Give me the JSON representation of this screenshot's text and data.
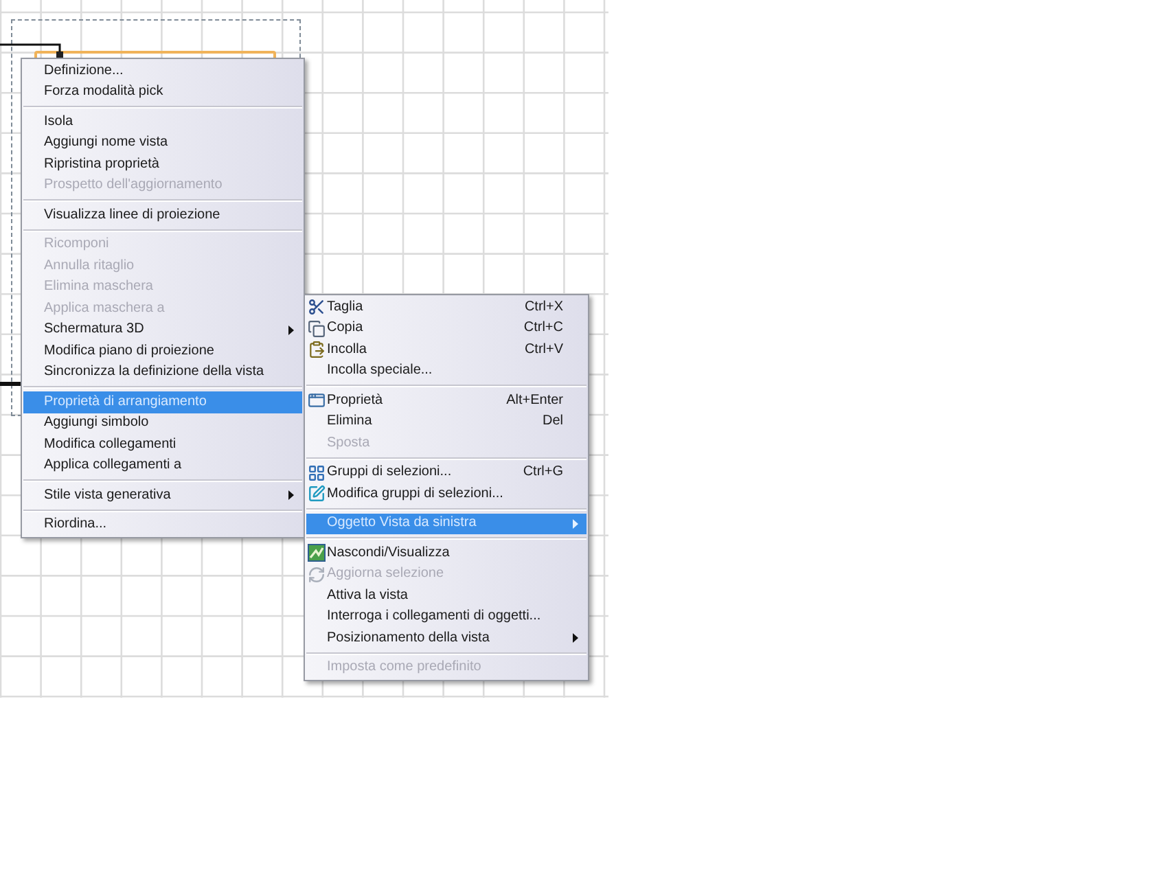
{
  "view_object_submenu": {
    "items": [
      {
        "kind": "command",
        "label": "Definizione...",
        "disabled": false,
        "selected": false,
        "submenu": false
      },
      {
        "kind": "command",
        "label": "Forza modalità pick",
        "disabled": false,
        "selected": false,
        "submenu": false
      },
      {
        "kind": "separator"
      },
      {
        "kind": "command",
        "label": "Isola",
        "disabled": false,
        "selected": false,
        "submenu": false
      },
      {
        "kind": "command",
        "label": "Aggiungi nome vista",
        "disabled": false,
        "selected": false,
        "submenu": false
      },
      {
        "kind": "command",
        "label": "Ripristina proprietà",
        "disabled": false,
        "selected": false,
        "submenu": false
      },
      {
        "kind": "command",
        "label": "Prospetto dell'aggiornamento",
        "disabled": true,
        "selected": false,
        "submenu": false
      },
      {
        "kind": "separator"
      },
      {
        "kind": "command",
        "label": "Visualizza linee di proiezione",
        "disabled": false,
        "selected": false,
        "submenu": false
      },
      {
        "kind": "separator"
      },
      {
        "kind": "command",
        "label": "Ricomponi",
        "disabled": true,
        "selected": false,
        "submenu": false
      },
      {
        "kind": "command",
        "label": "Annulla ritaglio",
        "disabled": true,
        "selected": false,
        "submenu": false
      },
      {
        "kind": "command",
        "label": "Elimina maschera",
        "disabled": true,
        "selected": false,
        "submenu": false
      },
      {
        "kind": "command",
        "label": "Applica maschera a",
        "disabled": true,
        "selected": false,
        "submenu": false
      },
      {
        "kind": "command",
        "label": "Schermatura 3D",
        "disabled": false,
        "selected": false,
        "submenu": true
      },
      {
        "kind": "command",
        "label": "Modifica piano di proiezione",
        "disabled": false,
        "selected": false,
        "submenu": false
      },
      {
        "kind": "command",
        "label": "Sincronizza la definizione della vista",
        "disabled": false,
        "selected": false,
        "submenu": false
      },
      {
        "kind": "separator"
      },
      {
        "kind": "command",
        "label": "Proprietà di arrangiamento",
        "disabled": false,
        "selected": true,
        "submenu": false
      },
      {
        "kind": "command",
        "label": "Aggiungi simbolo",
        "disabled": false,
        "selected": false,
        "submenu": false
      },
      {
        "kind": "command",
        "label": "Modifica collegamenti",
        "disabled": false,
        "selected": false,
        "submenu": false
      },
      {
        "kind": "command",
        "label": "Applica collegamenti a",
        "disabled": false,
        "selected": false,
        "submenu": false
      },
      {
        "kind": "separator"
      },
      {
        "kind": "command",
        "label": "Stile vista generativa",
        "disabled": false,
        "selected": false,
        "submenu": true
      },
      {
        "kind": "separator"
      },
      {
        "kind": "command",
        "label": "Riordina...",
        "disabled": false,
        "selected": false,
        "submenu": false
      }
    ]
  },
  "context_menu": {
    "items": [
      {
        "kind": "command",
        "label": "Taglia",
        "shortcut": "Ctrl+X",
        "icon": true,
        "disabled": false,
        "selected": false,
        "submenu": false
      },
      {
        "kind": "command",
        "label": "Copia",
        "shortcut": "Ctrl+C",
        "icon": true,
        "disabled": false,
        "selected": false,
        "submenu": false
      },
      {
        "kind": "command",
        "label": "Incolla",
        "shortcut": "Ctrl+V",
        "icon": true,
        "disabled": false,
        "selected": false,
        "submenu": false
      },
      {
        "kind": "command",
        "label": "Incolla speciale...",
        "icon": false,
        "disabled": false,
        "selected": false,
        "submenu": false
      },
      {
        "kind": "separator"
      },
      {
        "kind": "command",
        "label": "Proprietà",
        "shortcut": "Alt+Enter",
        "icon": true,
        "disabled": false,
        "selected": false,
        "submenu": false
      },
      {
        "kind": "command",
        "label": "Elimina",
        "shortcut": "Del",
        "icon": false,
        "disabled": false,
        "selected": false,
        "submenu": false
      },
      {
        "kind": "command",
        "label": "Sposta",
        "icon": false,
        "disabled": true,
        "selected": false,
        "submenu": false
      },
      {
        "kind": "separator"
      },
      {
        "kind": "command",
        "label": "Gruppi di selezioni...",
        "shortcut": "Ctrl+G",
        "icon": true,
        "disabled": false,
        "selected": false,
        "submenu": false
      },
      {
        "kind": "command",
        "label": "Modifica gruppi di selezioni...",
        "icon": true,
        "disabled": false,
        "selected": false,
        "submenu": false
      },
      {
        "kind": "separator"
      },
      {
        "kind": "command",
        "label": "Oggetto Vista da sinistra",
        "icon": false,
        "disabled": false,
        "selected": true,
        "submenu": true
      },
      {
        "kind": "separator"
      },
      {
        "kind": "command",
        "label": "Nascondi/Visualizza",
        "icon": true,
        "disabled": false,
        "selected": false,
        "submenu": false
      },
      {
        "kind": "command",
        "label": "Aggiorna selezione",
        "icon": true,
        "disabled": true,
        "selected": false,
        "submenu": false
      },
      {
        "kind": "command",
        "label": "Attiva la vista",
        "icon": false,
        "disabled": false,
        "selected": false,
        "submenu": false
      },
      {
        "kind": "command",
        "label": "Interroga i collegamenti di oggetti...",
        "icon": false,
        "disabled": false,
        "selected": false,
        "submenu": false
      },
      {
        "kind": "command",
        "label": "Posizionamento della vista",
        "icon": false,
        "disabled": false,
        "selected": false,
        "submenu": true
      },
      {
        "kind": "separator"
      },
      {
        "kind": "command",
        "label": "Imposta come predefinito",
        "icon": false,
        "disabled": true,
        "selected": false,
        "submenu": false
      }
    ]
  }
}
